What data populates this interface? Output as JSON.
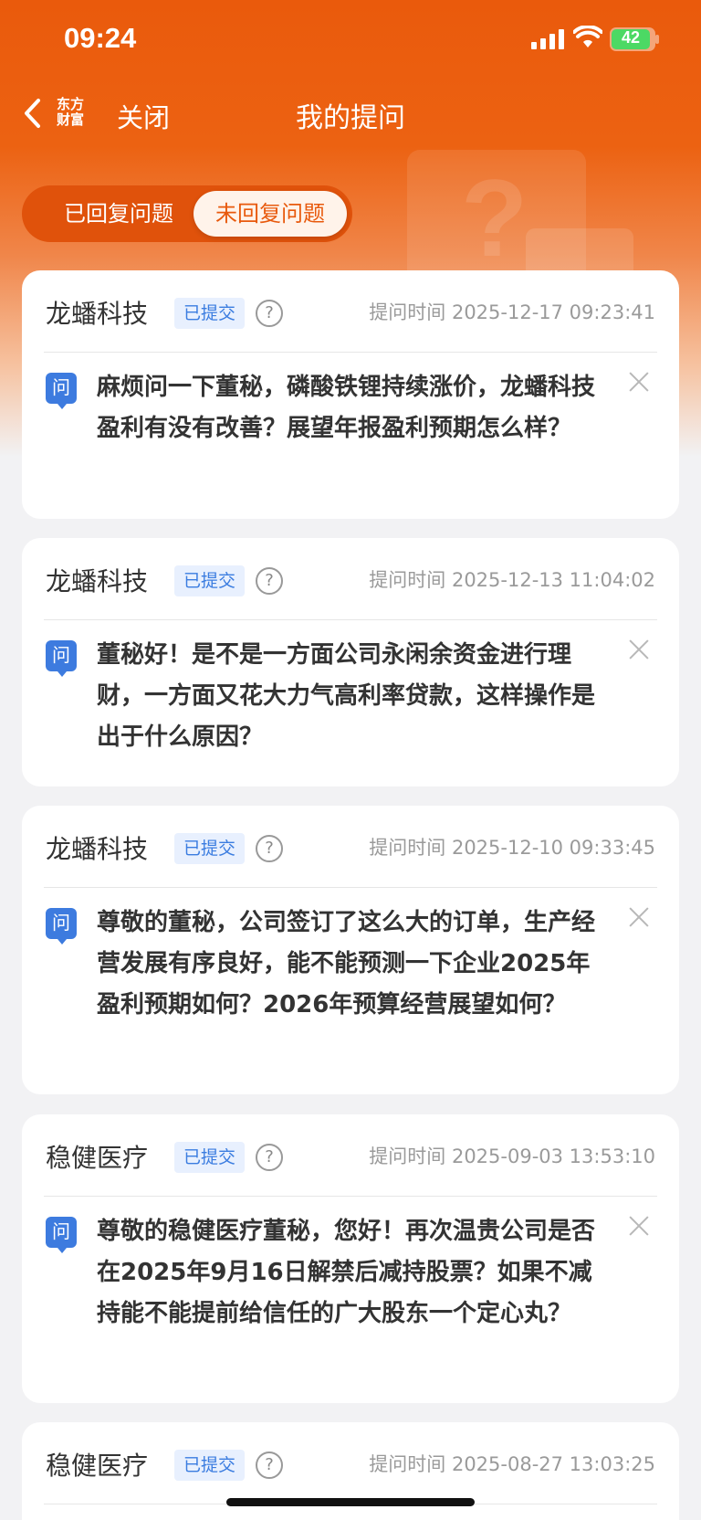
{
  "status_bar": {
    "time": "09:24",
    "battery": "42"
  },
  "nav": {
    "logo_text": "东方\n财富",
    "close_label": "关闭",
    "title": "我的提问"
  },
  "tabs": [
    {
      "label": "已回复问题",
      "active": false
    },
    {
      "label": "未回复问题",
      "active": true
    }
  ],
  "questions": [
    {
      "company": "龙蟠科技",
      "status": "已提交",
      "time": "提问时间 2025-12-17 09:23:41",
      "icon": "问",
      "text": "麻烦问一下董秘，磷酸铁锂持续涨价，龙蟠科技盈利有没有改善？展望年报盈利预期怎么样？"
    },
    {
      "company": "龙蟠科技",
      "status": "已提交",
      "time": "提问时间 2025-12-13 11:04:02",
      "icon": "问",
      "text": "董秘好！是不是一方面公司永闲余资金进行理财，一方面又花大力气高利率贷款，这样操作是出于什么原因？"
    },
    {
      "company": "龙蟠科技",
      "status": "已提交",
      "time": "提问时间 2025-12-10 09:33:45",
      "icon": "问",
      "text": "尊敬的董秘，公司签订了这么大的订单，生产经营发展有序良好，能不能预测一下企业2025年盈利预期如何？2026年预算经营展望如何？"
    },
    {
      "company": "稳健医疗",
      "status": "已提交",
      "time": "提问时间 2025-09-03 13:53:10",
      "icon": "问",
      "text": "尊敬的稳健医疗董秘，您好！再次温贵公司是否在2025年9月16日解禁后减持股票？如果不减持能不能提前给信任的广大股东一个定心丸？"
    },
    {
      "company": "稳健医疗",
      "status": "已提交",
      "time": "提问时间 2025-08-27 13:03:25",
      "icon": "问",
      "text": ""
    }
  ]
}
